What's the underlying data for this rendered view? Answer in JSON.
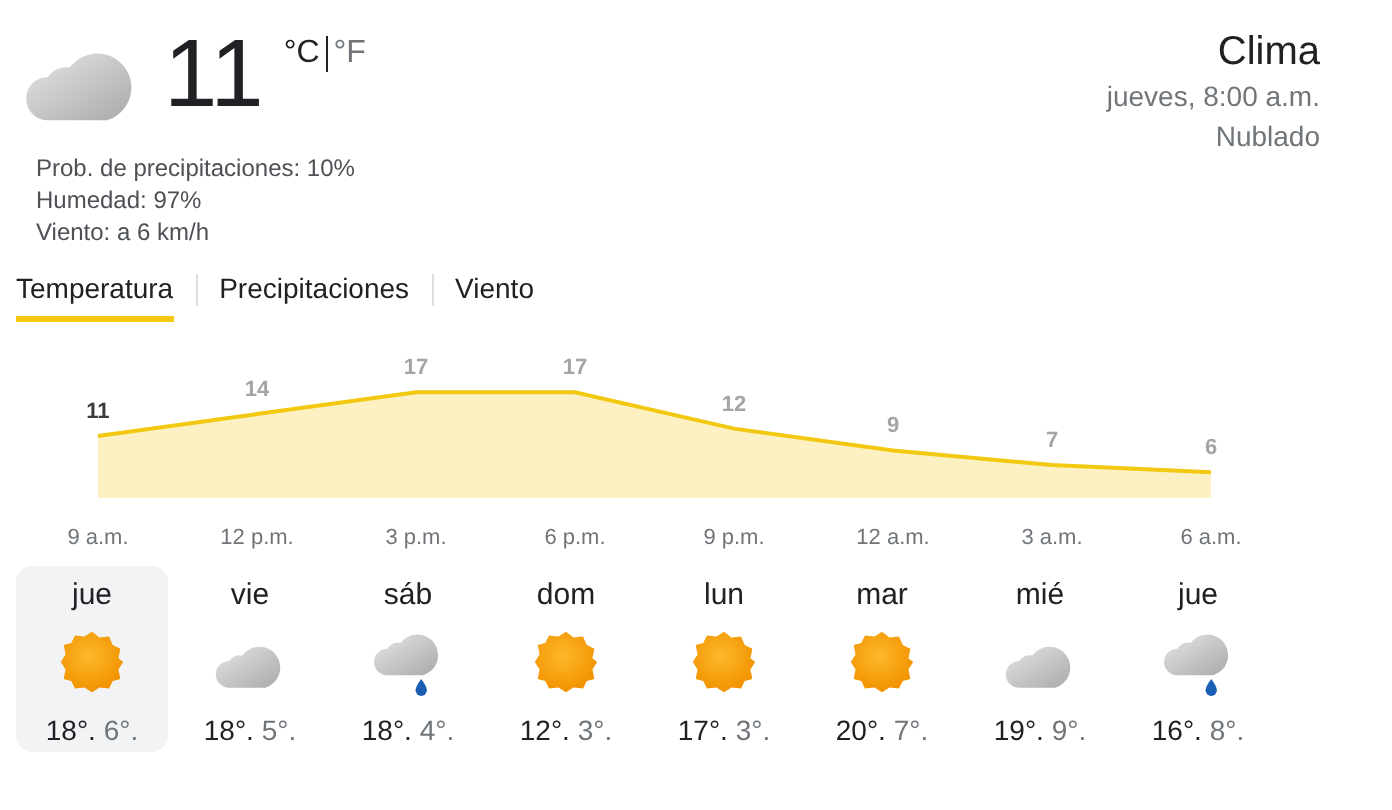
{
  "current": {
    "temperature": "11",
    "unit_c": "°C",
    "unit_f": "°F",
    "unit_c_selected": true,
    "details": [
      "Prob. de precipitaciones: 10%",
      "Humedad: 97%",
      "Viento: a 6 km/h"
    ]
  },
  "header": {
    "title": "Clima",
    "time": "jueves, 8:00 a.m.",
    "condition": "Nublado"
  },
  "tabs": [
    {
      "label": "Temperatura",
      "selected": true
    },
    {
      "label": "Precipitaciones",
      "selected": false
    },
    {
      "label": "Viento",
      "selected": false
    }
  ],
  "hourly": {
    "chart_data": {
      "type": "area",
      "categories": [
        "9 a.m.",
        "12 p.m.",
        "3 p.m.",
        "6 p.m.",
        "9 p.m.",
        "12 a.m.",
        "3 a.m.",
        "6 a.m."
      ],
      "series": [
        {
          "color": "#f2c811",
          "values": [
            11,
            14,
            17,
            17,
            12,
            9,
            7,
            6
          ]
        }
      ],
      "data_labels": true
    }
  },
  "days": [
    {
      "day": "jue",
      "kind": "sun",
      "high": "18°.",
      "low": "6°.",
      "selected": true
    },
    {
      "day": "vie",
      "kind": "cloud",
      "high": "18°.",
      "low": "5°.",
      "selected": false
    },
    {
      "day": "sáb",
      "kind": "rain",
      "high": "18°.",
      "low": "4°.",
      "selected": false
    },
    {
      "day": "dom",
      "kind": "sun",
      "high": "12°.",
      "low": "3°.",
      "selected": false
    },
    {
      "day": "lun",
      "kind": "sun",
      "high": "17°.",
      "low": "3°.",
      "selected": false
    },
    {
      "day": "mar",
      "kind": "sun",
      "high": "20°.",
      "low": "7°.",
      "selected": false
    },
    {
      "day": "mié",
      "kind": "cloud",
      "high": "19°.",
      "low": "9°.",
      "selected": false
    },
    {
      "day": "jue",
      "kind": "rain",
      "high": "16°.",
      "low": "8°.",
      "selected": false
    }
  ]
}
